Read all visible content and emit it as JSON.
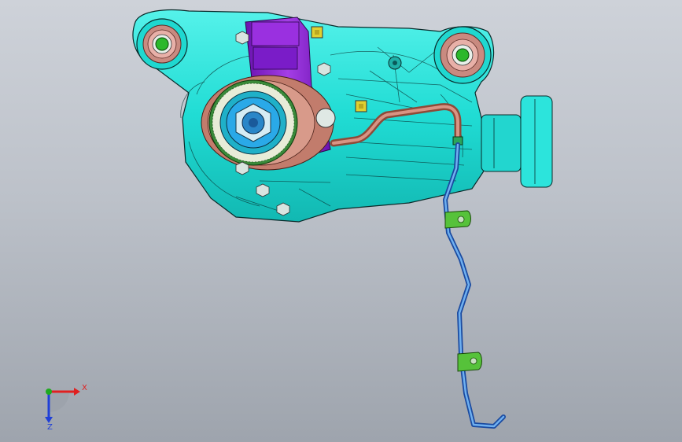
{
  "triad": {
    "x_label": "X",
    "z_label": "Z",
    "x_color": "#e02020",
    "y_color": "#1faa1f",
    "z_color": "#2040d8"
  },
  "model": {
    "housing_color": "#20e0d8",
    "edge_color": "#0a2a2a",
    "mount_color": "#8a22c8",
    "flange_color": "#c07a6a",
    "bushing_color": "#d28f86",
    "pipe_color": "#b86a55",
    "hose_color": "#2f7fdc",
    "bracket_color": "#56c23a",
    "bolt_color": "#e0d030",
    "hub_color": "#2aa9e8",
    "icons": [
      "gear-housing",
      "rubber-bushing",
      "pinion-flange",
      "breather-pipe",
      "vent-hose",
      "hose-bracket"
    ]
  }
}
